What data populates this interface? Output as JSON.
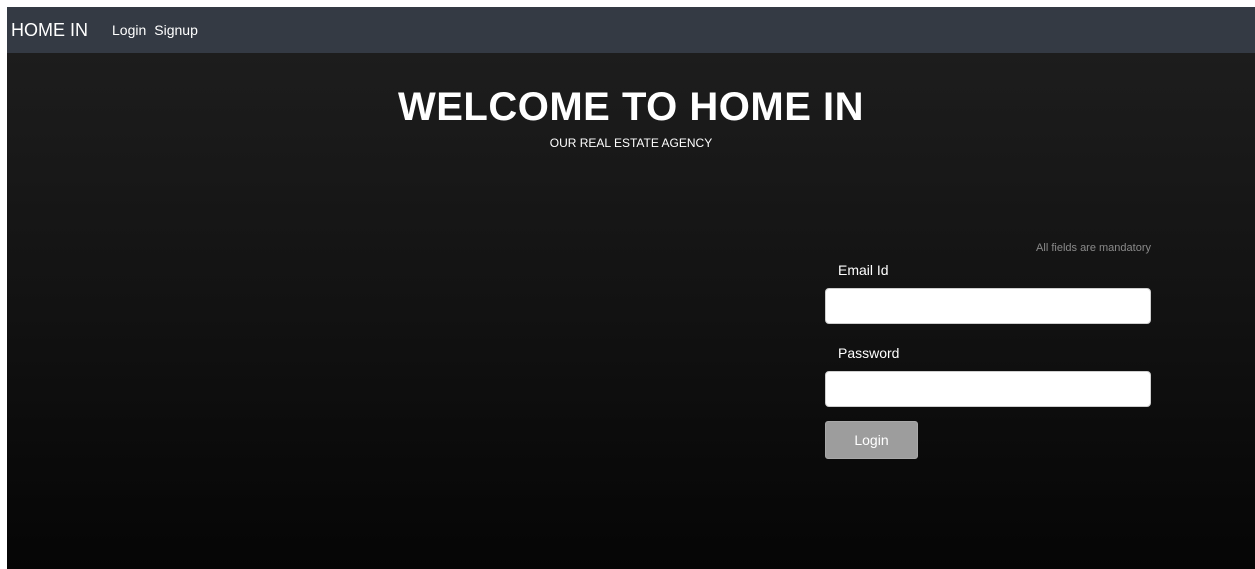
{
  "navbar": {
    "brand": "HOME IN",
    "links": [
      "Login",
      "Signup"
    ]
  },
  "hero": {
    "title": "WELCOME TO HOME IN",
    "subtitle": "OUR REAL ESTATE AGENCY"
  },
  "login_form": {
    "note": "All fields are mandatory",
    "email_label": "Email Id",
    "email_value": "",
    "password_label": "Password",
    "password_value": "",
    "submit_label": "Login"
  },
  "colors": {
    "navbar_bg": "#343a44",
    "hero_bg_top": "#1d1d1d",
    "hero_bg_bottom": "#050505",
    "button_bg": "#9d9d9d",
    "note_text": "#8a8a8a"
  }
}
